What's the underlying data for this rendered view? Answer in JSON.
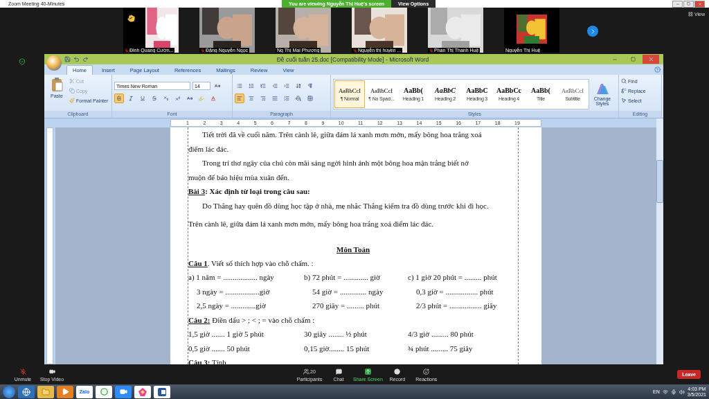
{
  "zoom": {
    "title": "Zoom Meeting 40-Minutes",
    "banner": "You are viewing Nguyễn Thị Huệ's screen",
    "view_options": "View Options",
    "view": "View"
  },
  "participants": [
    {
      "name": "Đinh Quang Cườn...",
      "muted": true,
      "hand_raised": true,
      "video": true
    },
    {
      "name": "Đặng Nguyễn Ngọc",
      "muted": true,
      "hand_raised": false,
      "video": true
    },
    {
      "name": "Ng Thị Mai Phương",
      "muted": false,
      "hand_raised": false,
      "video": true
    },
    {
      "name": "Nguyễn thị huyền ...",
      "muted": true,
      "hand_raised": false,
      "video": true
    },
    {
      "name": "Phan Thị Thanh Huệ",
      "muted": true,
      "hand_raised": false,
      "video": true
    },
    {
      "name": "Nguyễn Thị Huệ",
      "muted": false,
      "hand_raised": false,
      "video": false
    }
  ],
  "word": {
    "title": "Đề cuối tuần 25.doc [Compatibility Mode] - Microsoft Word",
    "tabs": [
      {
        "label": "Home",
        "selected": true
      },
      {
        "label": "Insert",
        "selected": false
      },
      {
        "label": "Page Layout",
        "selected": false
      },
      {
        "label": "References",
        "selected": false
      },
      {
        "label": "Mailings",
        "selected": false
      },
      {
        "label": "Review",
        "selected": false
      },
      {
        "label": "View",
        "selected": false
      }
    ],
    "clipboard": {
      "group": "Clipboard",
      "paste": "Paste",
      "cut": "Cut",
      "copy": "Copy",
      "format_painter": "Format Painter"
    },
    "font": {
      "group": "Font",
      "name": "Times New Roman",
      "size": "14",
      "bold": true
    },
    "paragraph": {
      "group": "Paragraph",
      "align_buttons": [
        {
          "selected": true
        },
        {
          "selected": false
        },
        {
          "selected": false
        },
        {
          "selected": false
        }
      ]
    },
    "styles": {
      "group": "Styles",
      "change_styles": "Change Styles",
      "items": [
        {
          "sample": "AaBbCcI",
          "label": "¶ Normal",
          "selected": true
        },
        {
          "sample": "AaBbCcI",
          "label": "¶ No Spaci...",
          "selected": false
        },
        {
          "sample": "AaBb(",
          "label": "Heading 1",
          "selected": false
        },
        {
          "sample": "AaBbC",
          "label": "Heading 2",
          "selected": false
        },
        {
          "sample": "AaBbC",
          "label": "Heading 3",
          "selected": false
        },
        {
          "sample": "AaBbCc",
          "label": "Heading 4",
          "selected": false
        },
        {
          "sample": "AaBb(",
          "label": "Title",
          "selected": false
        },
        {
          "sample": "AaBbCcI",
          "label": "Subtitle",
          "selected": false
        }
      ]
    },
    "editing": {
      "group": "Editing",
      "find": "Find",
      "replace": "Replace",
      "select": "Select"
    },
    "ruler": [
      "1",
      "2",
      "3",
      "4",
      "5",
      "6",
      "7",
      "8",
      "9",
      "10",
      "11",
      "12",
      "13",
      "14",
      "15",
      "16",
      "17",
      "18",
      "19"
    ]
  },
  "document": [
    {
      "kind": "line",
      "indent": true,
      "text": "Tiết trời đã về cuối năm. Trên cành lê, giữa đám lá xanh mơn mởn, mấy bông hoa trắng xoá"
    },
    {
      "kind": "line",
      "indent": false,
      "text": "điểm lác đác."
    },
    {
      "kind": "line",
      "indent": true,
      "text": "Trong trí thơ ngây của chú còn mãi sáng ngời hình ảnh một bông hoa mận trắng biết nở"
    },
    {
      "kind": "line",
      "indent": false,
      "text": "muộn để báo hiệu mùa xuân đến."
    },
    {
      "kind": "heading",
      "label": "Bài 3",
      "text": ": Xác định từ loại trong câu sau:"
    },
    {
      "kind": "line",
      "indent": true,
      "text": "Do Thắng hay quên đồ dùng học tập ở nhà, mẹ  nhắc Thắng kiểm tra đồ dùng trước khi đi học."
    },
    {
      "kind": "line",
      "indent": false,
      "text": "Trên cành lê, giữa đám lá xanh mơn mởn, mấy bông hoa trắng xoá điểm lác đác."
    },
    {
      "kind": "title",
      "text": "Môn Toán"
    },
    {
      "kind": "heading",
      "label": "Câu 1",
      "text": ". Viết số thích hợp vào chỗ chấm. :"
    },
    {
      "kind": "columns",
      "indent": false,
      "cells": [
        "a) 1 năm = .................. ngày",
        "b) 72 phút = ............. giờ",
        "c) 1 giờ 20 phút = ......... phút"
      ]
    },
    {
      "kind": "columns",
      "indent": true,
      "cells": [
        "3 ngày = ..................giờ",
        "54 giờ = .............. ngày",
        "0,3 giờ = ................. phút"
      ]
    },
    {
      "kind": "columns",
      "indent": true,
      "cells": [
        "2,5 ngày = .............giờ",
        "270 giây = ......... phút",
        "2/3 phút = ................. giây"
      ]
    },
    {
      "kind": "heading",
      "label": "Câu 2:",
      "text": " Điền dấu > ; < ; = vào chỗ chấm :"
    },
    {
      "kind": "columns",
      "indent": false,
      "cells": [
        "1,5 giờ ....... 1 giờ 5 phút",
        "30 giây ........ ½ phút",
        "4/3 giờ ......... 80 phút"
      ]
    },
    {
      "kind": "columns",
      "indent": false,
      "cells": [
        "0,5 giờ ....... 50 phút",
        "0,15 giờ........ 15 phút",
        "¾ phút ......... 75 giây"
      ]
    },
    {
      "kind": "heading",
      "label": "Câu 3:",
      "text": "  Tính"
    }
  ],
  "controls": {
    "unmute": "Unmute",
    "stop_video": "Stop Video",
    "participants": "Participants",
    "participant_count": "20",
    "chat": "Chat",
    "share_screen": "Share Screen",
    "record": "Record",
    "reactions": "Reactions",
    "leave": "Leave"
  },
  "taskbar": {
    "apps": [
      {
        "kind": "ie"
      },
      {
        "kind": "folder"
      },
      {
        "kind": "media"
      },
      {
        "kind": "zalo",
        "label": "Zalo"
      },
      {
        "kind": "green"
      },
      {
        "kind": "zoom"
      },
      {
        "kind": "colorful"
      },
      {
        "kind": "word"
      }
    ],
    "language": "EN",
    "time": "4:03 PM",
    "date": "3/5/2021"
  }
}
